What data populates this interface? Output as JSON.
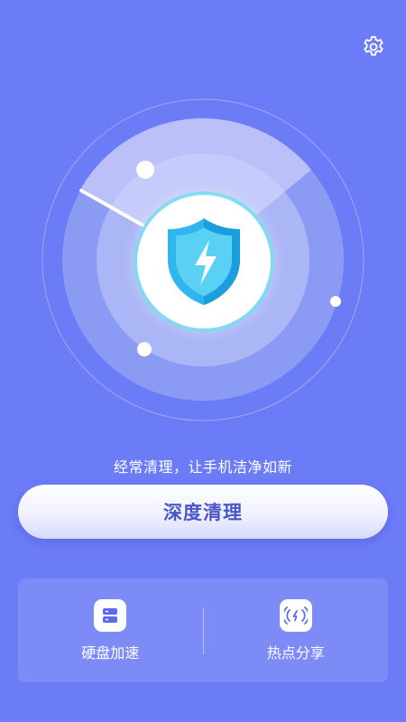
{
  "header": {
    "settings_icon": "gear-icon"
  },
  "scanner": {
    "center_icon": "shield-lightning-icon"
  },
  "main": {
    "tagline": "经常清理，让手机洁净如新",
    "deep_clean_label": "深度清理"
  },
  "tools": [
    {
      "label": "硬盘加速",
      "icon": "storage-icon"
    },
    {
      "label": "热点分享",
      "icon": "hotspot-icon"
    }
  ],
  "colors": {
    "background": "#6c7bf6",
    "button_text": "#4b56c9",
    "shield": "#2fb6ee"
  }
}
